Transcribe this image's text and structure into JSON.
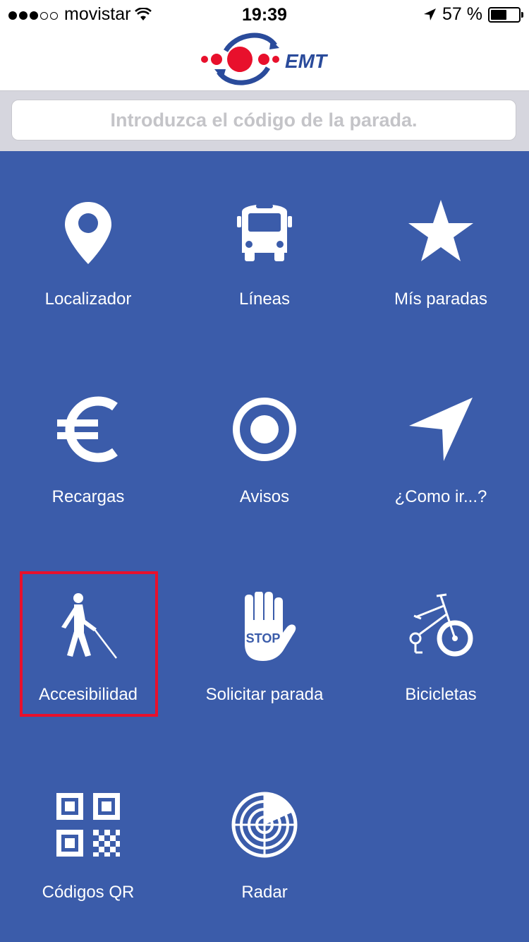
{
  "status_bar": {
    "carrier": "movistar",
    "time": "19:39",
    "battery_percent": "57 %",
    "battery_level": 0.57,
    "signal_filled": 3,
    "signal_total": 5
  },
  "header": {
    "logo_text": "EMT"
  },
  "search": {
    "placeholder": "Introduzca el código de la parada."
  },
  "menu": {
    "items": [
      {
        "label": "Localizador",
        "icon": "map-pin-icon"
      },
      {
        "label": "Líneas",
        "icon": "bus-icon"
      },
      {
        "label": "Mís paradas",
        "icon": "star-icon"
      },
      {
        "label": "Recargas",
        "icon": "euro-icon"
      },
      {
        "label": "Avisos",
        "icon": "target-icon"
      },
      {
        "label": "¿Como ir...?",
        "icon": "navigation-arrow-icon"
      },
      {
        "label": "Accesibilidad",
        "icon": "blind-person-icon"
      },
      {
        "label": "Solicitar parada",
        "icon": "stop-hand-icon"
      },
      {
        "label": "Bicicletas",
        "icon": "bicycle-icon"
      },
      {
        "label": "Códigos QR",
        "icon": "qr-code-icon"
      },
      {
        "label": "Radar",
        "icon": "radar-icon"
      }
    ]
  },
  "colors": {
    "background": "#3b5caa",
    "highlight": "#e8102c",
    "logo_red": "#e8102c",
    "logo_blue": "#2a4b9b"
  }
}
